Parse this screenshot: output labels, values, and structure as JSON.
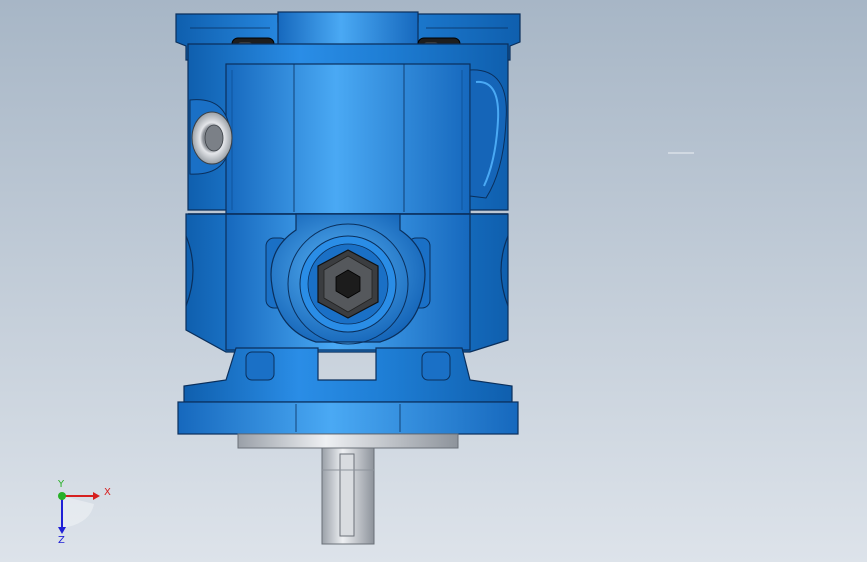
{
  "viewport": {
    "background_top": "#a7b6c6",
    "background_bottom": "#dde3ea"
  },
  "model": {
    "body_color": "#1f7fd6",
    "body_highlight": "#45a6f2",
    "body_shadow": "#0d4f95",
    "edge_color": "#0a2f5c",
    "shaft_color": "#c8ccd2",
    "bolt_color": "#2b2b2b"
  },
  "triad": {
    "x_label": "X",
    "y_label": "Y",
    "z_label": "Z",
    "x_color": "#d62020",
    "y_color": "#28b028",
    "z_color": "#2020d6"
  }
}
